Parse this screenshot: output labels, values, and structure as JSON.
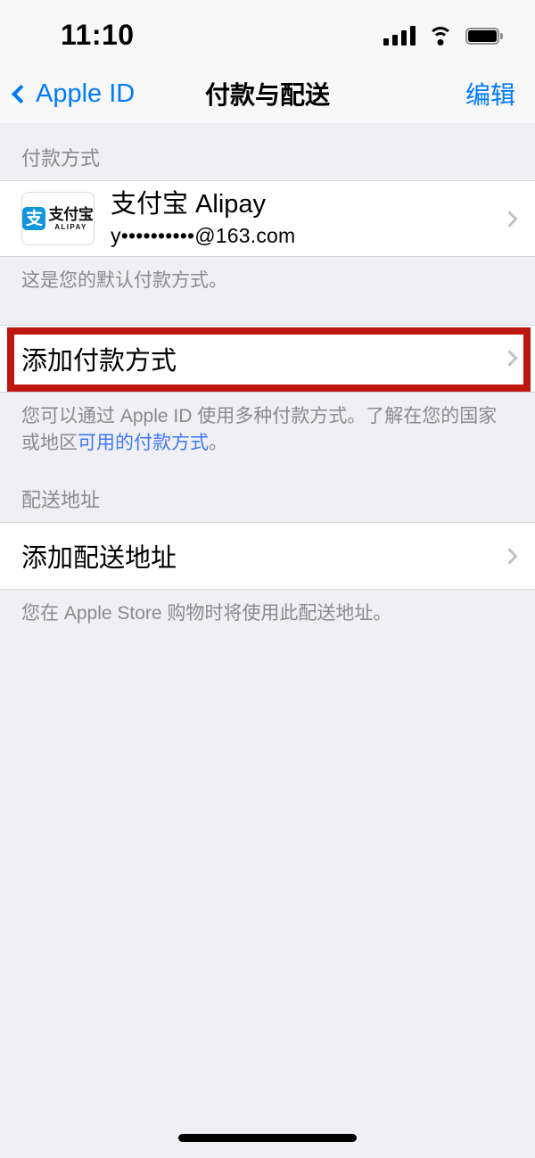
{
  "status_bar": {
    "time": "11:10",
    "signal_icon": "cellular-signal-icon",
    "wifi_icon": "wifi-icon",
    "battery_icon": "battery-icon"
  },
  "nav_bar": {
    "back_label": "Apple ID",
    "title": "付款与配送",
    "edit_label": "编辑"
  },
  "payment_section": {
    "header": "付款方式",
    "alipay_row": {
      "logo_mark": "支",
      "logo_cn": "支付宝",
      "logo_en": "ALIPAY",
      "title": "支付宝 Alipay",
      "subtitle": "y••••••••••@163.com"
    },
    "default_note": "这是您的默认付款方式。",
    "add_payment_label": "添加付款方式",
    "footer_part1": "您可以通过 Apple ID 使用多种付款方式。了解在您的国家或地区",
    "footer_link": "可用的付款方式",
    "footer_part2": "。"
  },
  "shipping_section": {
    "header": "配送地址",
    "add_address_label": "添加配送地址",
    "footer": "您在 Apple Store 购物时将使用此配送地址。"
  },
  "annotation": {
    "highlight_color": "#BE1710",
    "target": "添加付款方式"
  },
  "colors": {
    "accent_blue": "#007AFF",
    "link_blue": "#3F79F5",
    "background": "#F0EFF4",
    "row_background": "#FFFFFF",
    "secondary_text": "#8A8A8E"
  }
}
